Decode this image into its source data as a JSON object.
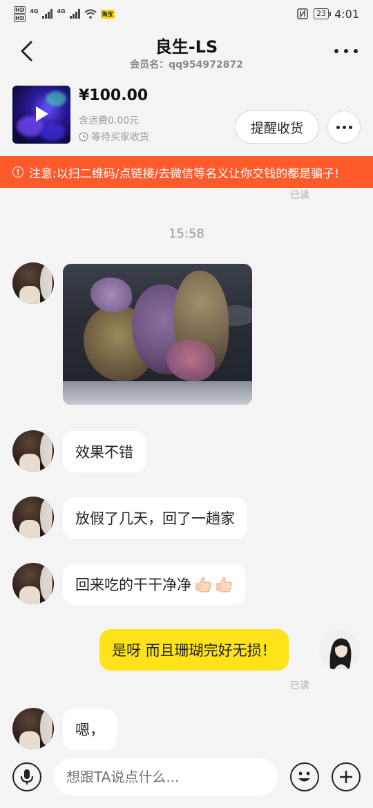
{
  "status_bar": {
    "hd1": "HD",
    "hd2": "HD",
    "net1": "4G",
    "net2": "4G",
    "app_badge": "淘宝",
    "battery": "23",
    "time": "4:01"
  },
  "header": {
    "title": "良生-LS",
    "subtitle": "会员名：qq954972872"
  },
  "product": {
    "price": "¥100.00",
    "shipping": "含运费0.00元",
    "status": "等待买家收货",
    "remind_button": "提醒收货"
  },
  "warning": {
    "text": "注意:以扫二维码/点链接/去微信等名义让你交钱的都是骗子!"
  },
  "chat": {
    "read_top": "已读",
    "time_divider": "15:58",
    "messages": [
      {
        "from": "other",
        "type": "image"
      },
      {
        "from": "other",
        "text": "效果不错"
      },
      {
        "from": "other",
        "text": "放假了几天，回了一趟家"
      },
      {
        "from": "other",
        "text": "回来吃的干干净净"
      },
      {
        "from": "me",
        "text": "是呀 而且珊瑚完好无损！"
      },
      {
        "from": "other",
        "text": "嗯，"
      }
    ],
    "read_mine": "已读"
  },
  "input_bar": {
    "placeholder": "想跟TA说点什么..."
  },
  "colors": {
    "warning_bg": "#ff5a2c",
    "my_bubble": "#ffe31a",
    "background": "#f4f4f4"
  }
}
